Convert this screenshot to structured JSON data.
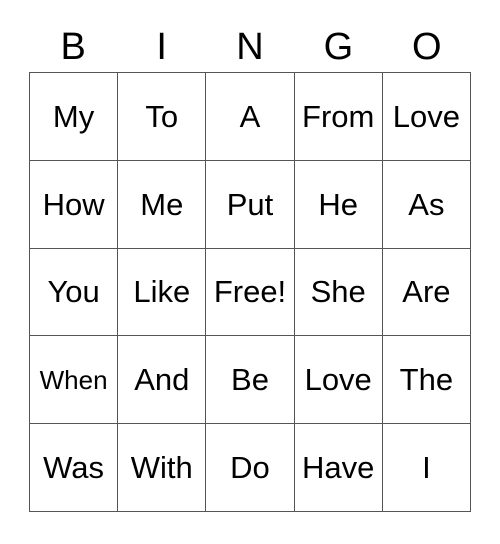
{
  "card": {
    "title": "BINGO",
    "header_letters": [
      "B",
      "I",
      "N",
      "G",
      "O"
    ],
    "free_space_label": "Free!",
    "free_space_position": {
      "row": 2,
      "col": 2
    },
    "grid_rows": 5,
    "grid_cols": 5,
    "text_color": "#000000",
    "border_color": "#555555",
    "background_color": "#ffffff",
    "rows": [
      {
        "cells": [
          {
            "text": "My"
          },
          {
            "text": "To"
          },
          {
            "text": "A"
          },
          {
            "text": "From"
          },
          {
            "text": "Love"
          }
        ]
      },
      {
        "cells": [
          {
            "text": "How"
          },
          {
            "text": "Me"
          },
          {
            "text": "Put"
          },
          {
            "text": "He"
          },
          {
            "text": "As"
          }
        ]
      },
      {
        "cells": [
          {
            "text": "You"
          },
          {
            "text": "Like"
          },
          {
            "text": "Free!"
          },
          {
            "text": "She"
          },
          {
            "text": "Are"
          }
        ]
      },
      {
        "cells": [
          {
            "text": "When"
          },
          {
            "text": "And"
          },
          {
            "text": "Be"
          },
          {
            "text": "Love"
          },
          {
            "text": "The"
          }
        ]
      },
      {
        "cells": [
          {
            "text": "Was"
          },
          {
            "text": "With"
          },
          {
            "text": "Do"
          },
          {
            "text": "Have"
          },
          {
            "text": "I"
          }
        ]
      }
    ]
  }
}
